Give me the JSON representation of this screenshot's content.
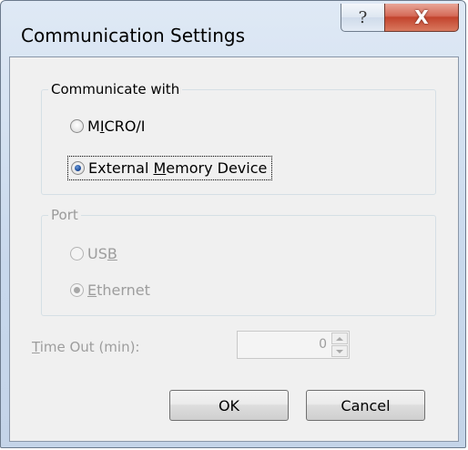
{
  "window": {
    "title": "Communication Settings",
    "help_glyph": "?",
    "close_glyph": "X"
  },
  "communicate_with": {
    "legend": "Communicate with",
    "options": [
      {
        "pre": "M",
        "mnemonic": "I",
        "post": "CRO/I",
        "selected": false
      },
      {
        "pre": "External ",
        "mnemonic": "M",
        "post": "emory Device",
        "selected": true,
        "focused": true
      }
    ]
  },
  "port": {
    "legend": "Port",
    "enabled": false,
    "options": [
      {
        "pre": "US",
        "mnemonic": "B",
        "post": "",
        "selected": false
      },
      {
        "pre": "",
        "mnemonic": "E",
        "post": "thernet",
        "selected": true
      }
    ]
  },
  "timeout": {
    "label_mnemonic": "T",
    "label_rest": "ime Out (min):",
    "value": "0",
    "enabled": false
  },
  "buttons": {
    "ok": "OK",
    "cancel": "Cancel"
  },
  "colors": {
    "title_bar": "#c8d8ec",
    "close_button": "#c2432d",
    "client_bg": "#f0f0f0",
    "disabled_text": "#9d9d9d"
  },
  "icons": {
    "help": "question-mark-icon",
    "close": "close-x-icon"
  }
}
